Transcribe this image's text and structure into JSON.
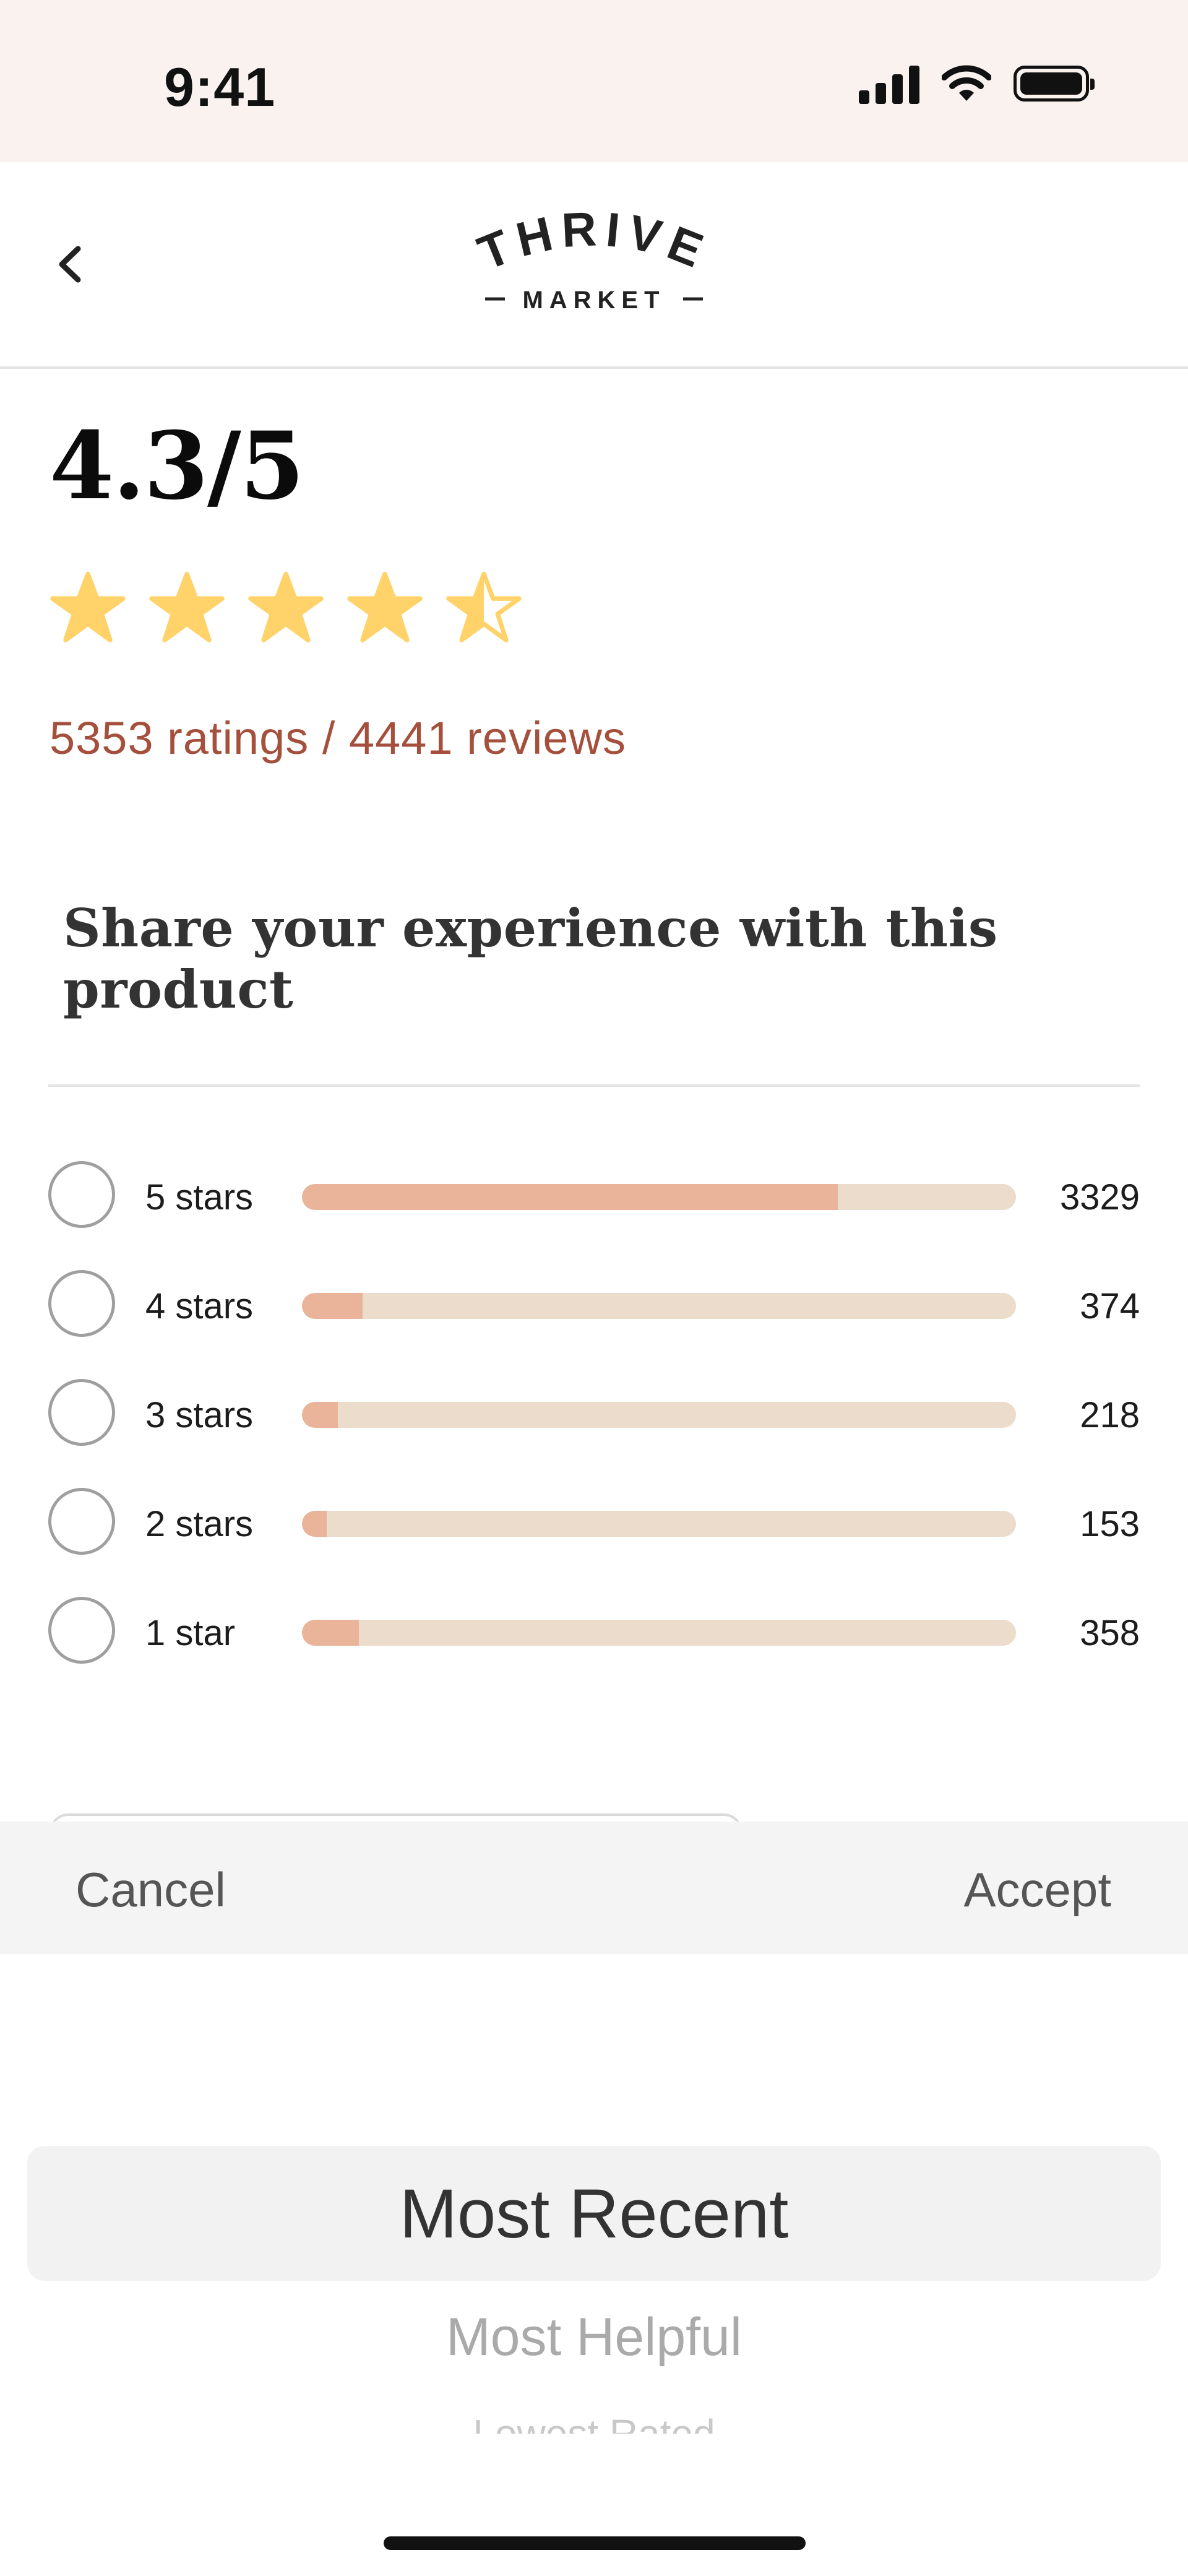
{
  "status_bar": {
    "time": "9:41",
    "icons": [
      "signal-icon",
      "wifi-icon",
      "battery-icon"
    ]
  },
  "header": {
    "back_icon": "chevron-left-icon",
    "logo_top": "THRIVE",
    "logo_bottom": "MARKET"
  },
  "rating": {
    "score": "4.3/5",
    "stars": 4.5,
    "counts": "5353 ratings / 4441 reviews"
  },
  "share_heading": "Share your experience with this product",
  "breakdown": [
    {
      "label": "5 stars",
      "count": "3329",
      "fraction": 0.75
    },
    {
      "label": "4 stars",
      "count": "374",
      "fraction": 0.085
    },
    {
      "label": "3 stars",
      "count": "218",
      "fraction": 0.05
    },
    {
      "label": "2 stars",
      "count": "153",
      "fraction": 0.035
    },
    {
      "label": "1 star",
      "count": "358",
      "fraction": 0.08
    }
  ],
  "picker": {
    "cancel_label": "Cancel",
    "accept_label": "Accept",
    "options": [
      "Most Recent",
      "Most Helpful",
      "Lowest Rated"
    ],
    "selected": "Most Recent"
  },
  "colors": {
    "accent": "#a4503c",
    "star": "#ffd36a",
    "bar_fill": "#e9b49a",
    "bar_track": "#ecdccc",
    "status_bg": "#f9f2ee"
  }
}
